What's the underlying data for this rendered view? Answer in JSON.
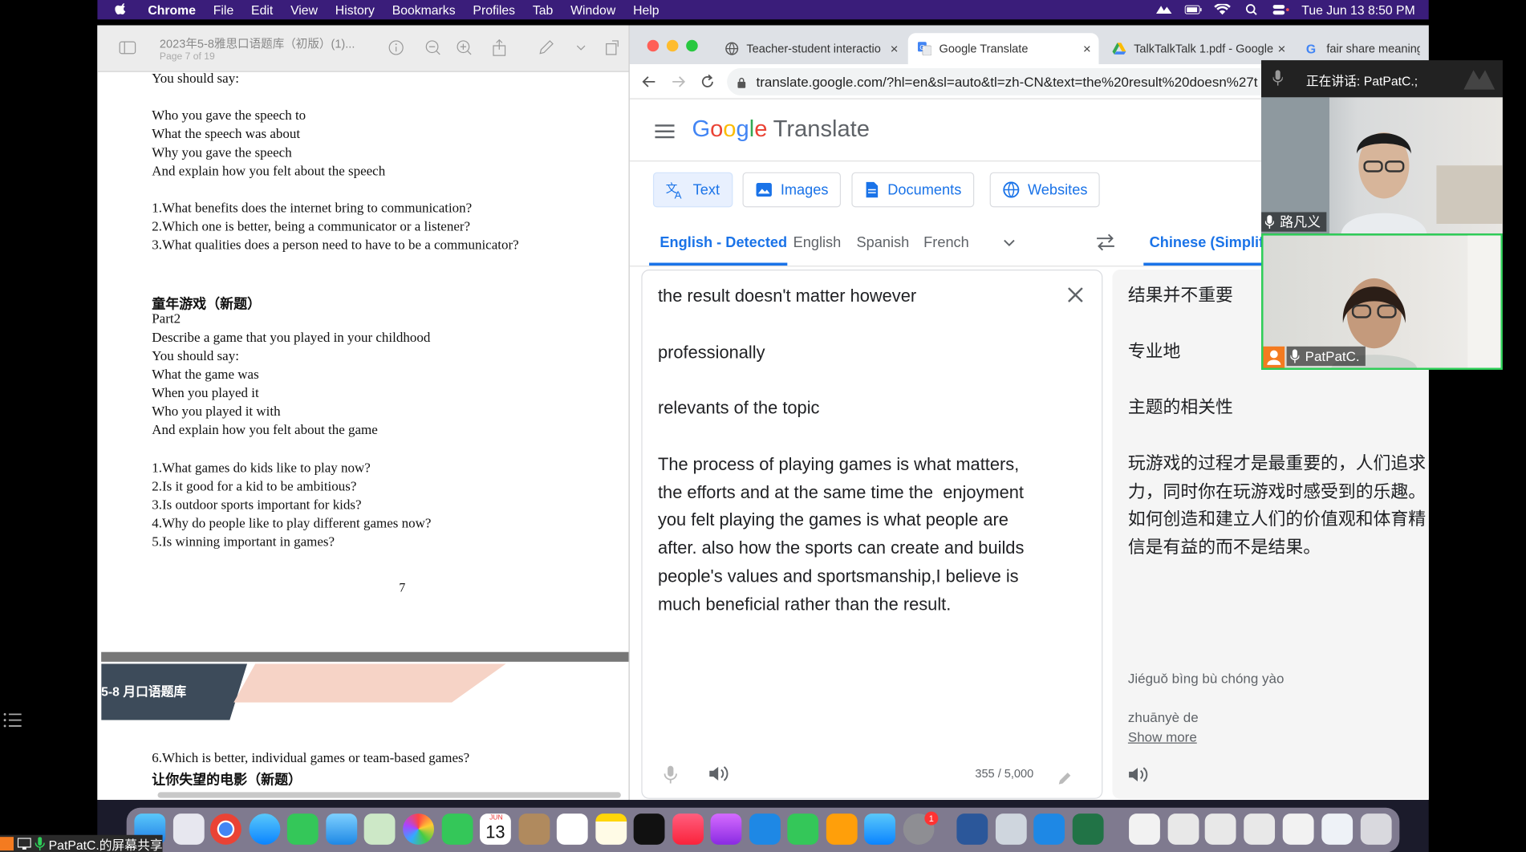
{
  "menubar": {
    "app": "Chrome",
    "items": [
      "File",
      "Edit",
      "View",
      "History",
      "Bookmarks",
      "Profiles",
      "Tab",
      "Window",
      "Help"
    ],
    "clock": "Tue Jun 13  8:50 PM"
  },
  "pdf": {
    "title": "2023年5-8雅思口语题库（初版）(1)...",
    "page_label": "Page 7 of 19",
    "lines": [
      "You should say:",
      "Who you gave the speech to",
      "What the speech was about",
      "Why you gave the speech",
      "And explain how you felt about the speech",
      "1.What benefits does the internet bring to communication?",
      "2.Which one is better, being a communicator or a listener?",
      "3.What qualities does a person need to have to be a communicator?",
      "童年游戏（新题）",
      "Part2",
      "Describe a game that you played in your childhood",
      "You should say:",
      "What the game was",
      "When you played it",
      "Who you played it with",
      "And explain how you felt about the game",
      "1.What games do kids like to play now?",
      "2.Is it good for a kid to be ambitious?",
      "3.Is outdoor sports important for kids?",
      "4.Why do people like to play different games now?",
      "5.Is winning important in games?"
    ],
    "page_number": "7",
    "banner": "5-8 月口语题库",
    "next_lines": [
      "6.Which is better, individual games or team-based games?",
      "让你失望的电影（新题）"
    ]
  },
  "chrome": {
    "tabs": [
      {
        "title": "Teacher-student interactio"
      },
      {
        "title": "Google Translate"
      },
      {
        "title": "TalkTalkTalk 1.pdf - Google"
      },
      {
        "title": "fair share meaning -"
      }
    ],
    "url": "translate.google.com/?hl=en&sl=auto&tl=zh-CN&text=the%20result%20doesn%27t"
  },
  "translate": {
    "logo_google": "Google",
    "logo_translate": "Translate",
    "modes": [
      "Text",
      "Images",
      "Documents",
      "Websites"
    ],
    "source_langs": [
      "English - Detected",
      "English",
      "Spanish",
      "French"
    ],
    "target_lang": "Chinese (Simplifie",
    "source_text": "the result doesn't matter however\n\nprofessionally\n\nrelevants of the topic\n\nThe process of playing games is what matters,\nthe efforts and at the same time the  enjoyment\nyou felt playing the games is what people are\nafter. also how the sports can create and builds\npeople's values and sportsmanship,I believe is\nmuch beneficial rather than the result.",
    "char_count": "355 / 5,000",
    "target_text": "结果并不重要\n\n专业地\n\n主题的相关性\n\n玩游戏的过程才是最重要的，人们追求\n力，同时你在玩游戏时感受到的乐趣。\n如何创造和建立人们的价值观和体育精\n信是有益的而不是结果。",
    "romanization_1": "Jiéguǒ bìng bù chóng yào",
    "romanization_2": "zhuānyè de",
    "show_more": "Show more"
  },
  "video": {
    "speaking_label": "正在讲话:  PatPatC.;",
    "participants": [
      {
        "name": "路凡义"
      },
      {
        "name": "PatPatC."
      }
    ]
  },
  "dock": {
    "calendar_month": "JUN",
    "calendar_day": "13",
    "badge": "1"
  },
  "share_indicator": "PatPatC.的屏幕共享",
  "colors": {
    "menubar": "#3a1d7a",
    "accent_blue": "#1a73e8",
    "active_speaker": "#2ed159"
  }
}
